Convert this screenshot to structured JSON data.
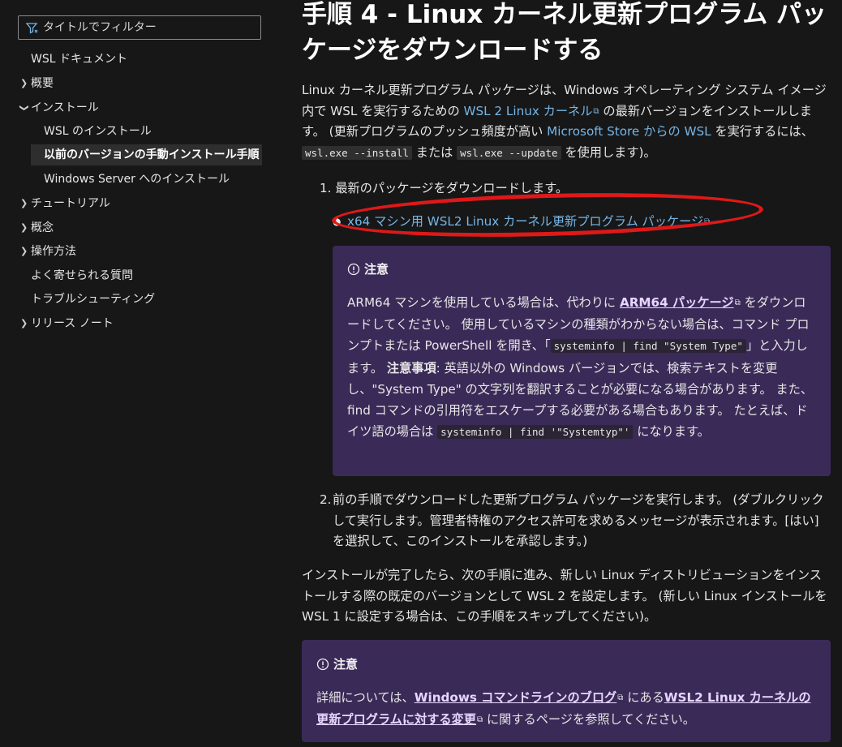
{
  "sidebar": {
    "filter_placeholder": "タイトルでフィルター",
    "items": [
      {
        "label": "WSL ドキュメント"
      },
      {
        "label": "概要"
      },
      {
        "label": "インストール"
      },
      {
        "label": "WSL のインストール"
      },
      {
        "label": "以前のバージョンの手動インストール手順"
      },
      {
        "label": "Windows Server へのインストール"
      },
      {
        "label": "チュートリアル"
      },
      {
        "label": "概念"
      },
      {
        "label": "操作方法"
      },
      {
        "label": "よく寄せられる質問"
      },
      {
        "label": "トラブルシューティング"
      },
      {
        "label": "リリース ノート"
      }
    ]
  },
  "main": {
    "title": "手順 4 - Linux カーネル更新プログラム パッケージをダウンロードする",
    "intro": {
      "t1": "Linux カーネル更新プログラム パッケージは、Windows オペレーティング システム イメージ内で WSL を実行するための ",
      "link1": "WSL 2 Linux カーネル",
      "t2": " の最新バージョンをインストールします。 (更新プログラムのプッシュ頻度が高い ",
      "link2": "Microsoft Store からの WSL",
      "t3": " を実行するには、",
      "code1": "wsl.exe --install",
      "t4": " または ",
      "code2": "wsl.exe --update",
      "t5": " を使用します)。"
    },
    "step1": {
      "number": "1.",
      "text": "最新のパッケージをダウンロードします。",
      "link": "x64 マシン用 WSL2 Linux カーネル更新プログラム パッケージ"
    },
    "note1": {
      "title": "注意",
      "t1": "ARM64 マシンを使用している場合は、代わりに ",
      "link": "ARM64 パッケージ",
      "t2": " をダウンロードしてください。 使用しているマシンの種類がわからない場合は、コマンド プロンプトまたは PowerShell を開き、「",
      "code1": "systeminfo | find \"System Type\"",
      "t3": "」と入力します。 ",
      "bold": "注意事項",
      "t4": ": 英語以外の Windows バージョンでは、検索テキストを変更し、\"System Type\" の文字列を翻訳することが必要になる場合があります。 また、find コマンドの引用符をエスケープする必要がある場合もあります。 たとえば、ドイツ語の場合は ",
      "code2": "systeminfo | find '\"Systemtyp\"'",
      "t5": " になります。"
    },
    "step2": {
      "number": "2.",
      "text": "前の手順でダウンロードした更新プログラム パッケージを実行します。 (ダブルクリックして実行します。管理者特権のアクセス許可を求めるメッセージが表示されます。[はい] を選択して、このインストールを承認します。)"
    },
    "after": "インストールが完了したら、次の手順に進み、新しい Linux ディストリビューションをインストールする際の既定のバージョンとして WSL 2 を設定します。 (新しい Linux インストールを WSL 1 に設定する場合は、この手順をスキップしてください)。",
    "note2": {
      "title": "注意",
      "t1": "詳細については、",
      "link1": "Windows コマンドラインのブログ",
      "t2": " にある",
      "link2": "WSL2 Linux カーネルの更新プログラムに対する変更",
      "t3": " に関するページを参照してください。"
    }
  },
  "colors": {
    "background": "#171717",
    "link": "#75b6e7",
    "note_background": "#3a2a57",
    "annotation_circle": "#e01818"
  }
}
